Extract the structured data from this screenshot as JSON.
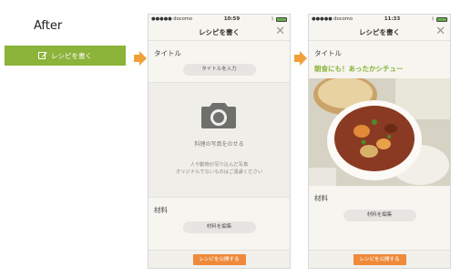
{
  "after_label": "After",
  "write_button": {
    "label": "レシピを書く"
  },
  "phone1": {
    "status": {
      "carrier": "●●●●● docomo",
      "time": "10:59"
    },
    "nav": {
      "title": "レシピを書く"
    },
    "title_section": {
      "label": "タイトル",
      "button": "タイトルを入力"
    },
    "photo": {
      "main_text": "料理の写真をのせる",
      "sub_text_line1": "人や動物が写り込んだ写真",
      "sub_text_line2": "オリジナルでないものはご遠慮ください"
    },
    "ingredients_section": {
      "label": "材料",
      "button": "材料を編集"
    },
    "publish_button": "レシピを公開する"
  },
  "phone2": {
    "status": {
      "carrier": "●●●●● docomo",
      "time": "11:33"
    },
    "nav": {
      "title": "レシピを書く"
    },
    "title_section": {
      "label": "タイトル",
      "value": "朝食にも！あったかシチュー"
    },
    "ingredients_section": {
      "label": "材料",
      "button": "材料を編集"
    },
    "publish_button": "レシピを公開する"
  },
  "colors": {
    "accent_green": "#8cb33a",
    "accent_orange": "#ef8a3a",
    "arrow_orange": "#f0a038"
  },
  "icons": [
    "pen-icon",
    "camera-icon",
    "close-icon",
    "battery-icon",
    "wifi-icon",
    "bluetooth-icon",
    "arrow-right-icon"
  ]
}
